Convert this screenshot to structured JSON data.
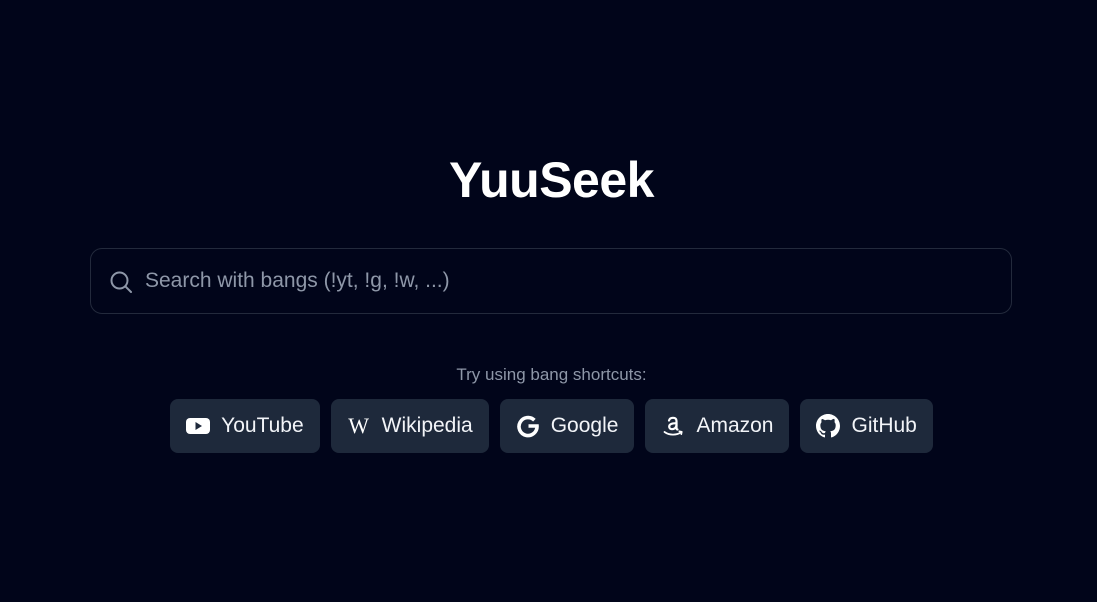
{
  "app": {
    "title": "YuuSeek"
  },
  "search": {
    "placeholder": "Search with bangs (!yt, !g, !w, ...)",
    "value": ""
  },
  "hint": {
    "text": "Try using bang shortcuts:"
  },
  "shortcuts": [
    {
      "label": "YouTube",
      "icon": "youtube-icon"
    },
    {
      "label": "Wikipedia",
      "icon": "wikipedia-icon"
    },
    {
      "label": "Google",
      "icon": "google-icon"
    },
    {
      "label": "Amazon",
      "icon": "amazon-icon"
    },
    {
      "label": "GitHub",
      "icon": "github-icon"
    }
  ],
  "colors": {
    "background": "#01051a",
    "button_background": "#1e293b",
    "search_border": "#232a3c",
    "muted_text": "#8e97a8",
    "text": "#ffffff"
  }
}
